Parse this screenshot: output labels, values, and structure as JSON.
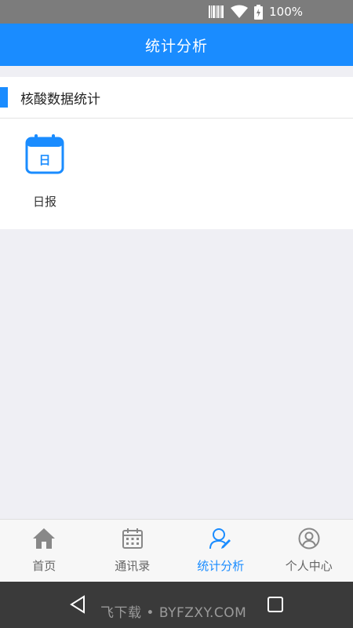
{
  "status_bar": {
    "battery_text": "100%"
  },
  "header": {
    "title": "统计分析"
  },
  "section": {
    "title": "核酸数据统计",
    "items": [
      {
        "label": "日报",
        "icon_char": "日"
      }
    ]
  },
  "tabbar": {
    "tabs": [
      {
        "label": "首页",
        "icon": "home-icon",
        "active": false
      },
      {
        "label": "通讯录",
        "icon": "calendar-icon",
        "active": false
      },
      {
        "label": "统计分析",
        "icon": "user-edit-icon",
        "active": true
      },
      {
        "label": "个人中心",
        "icon": "user-circle-icon",
        "active": false
      }
    ]
  },
  "navbar": {
    "watermark": "飞下载 • BYFZXY.COM"
  },
  "colors": {
    "accent": "#1a8cff",
    "status_bar": "#7c7c7c",
    "nav_bar": "#3a3a3a",
    "background": "#efeff4"
  }
}
